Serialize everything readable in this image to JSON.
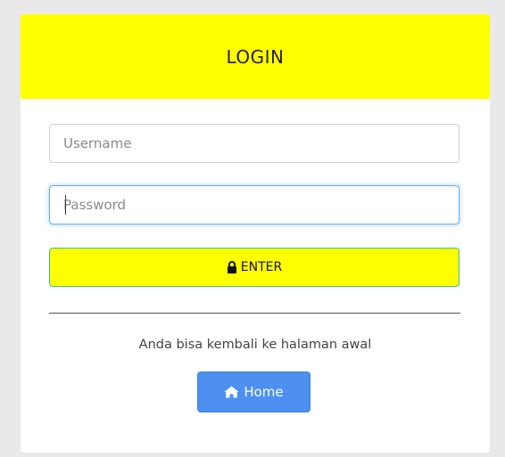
{
  "login_card": {
    "title": "LOGIN",
    "username": {
      "placeholder": "Username",
      "value": ""
    },
    "password": {
      "placeholder": "Password",
      "value": ""
    },
    "enter_button": {
      "label": "ENTER",
      "icon": "lock-icon"
    },
    "info_text": "Anda bisa kembali ke halaman awal",
    "home_button": {
      "label": "Home",
      "icon": "home-icon"
    }
  },
  "colors": {
    "header_bg": "#ffff00",
    "enter_bg": "#ffff00",
    "home_bg": "#4d90f0",
    "focus_border": "#66afe9",
    "page_bg": "#e9e9e9"
  }
}
